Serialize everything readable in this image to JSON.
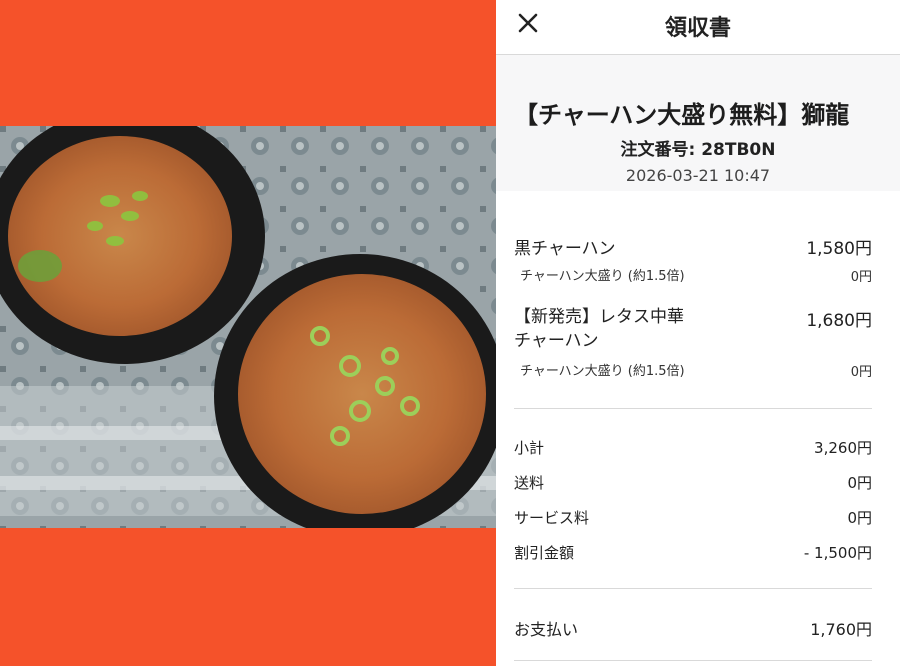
{
  "header": {
    "title": "領収書",
    "close_icon": "close-icon"
  },
  "order": {
    "store_name": "【チャーハン大盛り無料】獅龍",
    "order_number_label": "注文番号:",
    "order_number": "28TB0N",
    "datetime": "2026-03-21 10:47"
  },
  "items": [
    {
      "name": "黒チャーハン",
      "price": "1,580円",
      "option": "チャーハン大盛り (約1.5倍)",
      "option_price": "0円"
    },
    {
      "name_line1": "【新発売】レタス中華",
      "name_line2": "チャーハン",
      "price": "1,680円",
      "option": "チャーハン大盛り (約1.5倍)",
      "option_price": "0円"
    }
  ],
  "summary": {
    "subtotal_label": "小計",
    "subtotal": "3,260円",
    "delivery_label": "送料",
    "delivery": "0円",
    "service_label": "サービス料",
    "service": "0円",
    "discount_label": "割引金額",
    "discount": "- 1,500円"
  },
  "payment": {
    "label": "お支払い",
    "amount": "1,760円"
  },
  "colors": {
    "accent_orange": "#f5522a",
    "order_block_bg": "#f7f7f8",
    "divider": "#d9d9d9"
  }
}
